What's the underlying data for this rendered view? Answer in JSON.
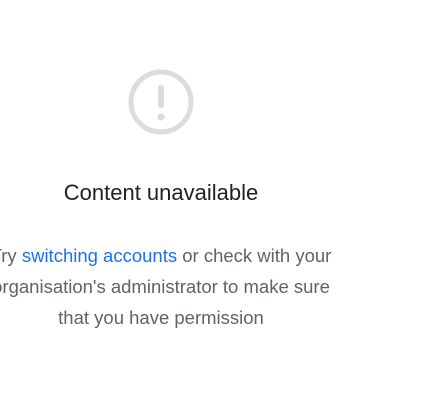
{
  "icon": {
    "name": "exclamation-circle-icon",
    "color": "#dadce0"
  },
  "title": "Content unavailable",
  "message": {
    "line1_prefix": "Try ",
    "link_text": "switching accounts",
    "line1_suffix": " or check with your",
    "line2": "organisation's administrator to make sure",
    "line3": "that you have permission"
  },
  "colors": {
    "title": "#202124",
    "body_text": "#5f6368",
    "link": "#1a73e8"
  }
}
